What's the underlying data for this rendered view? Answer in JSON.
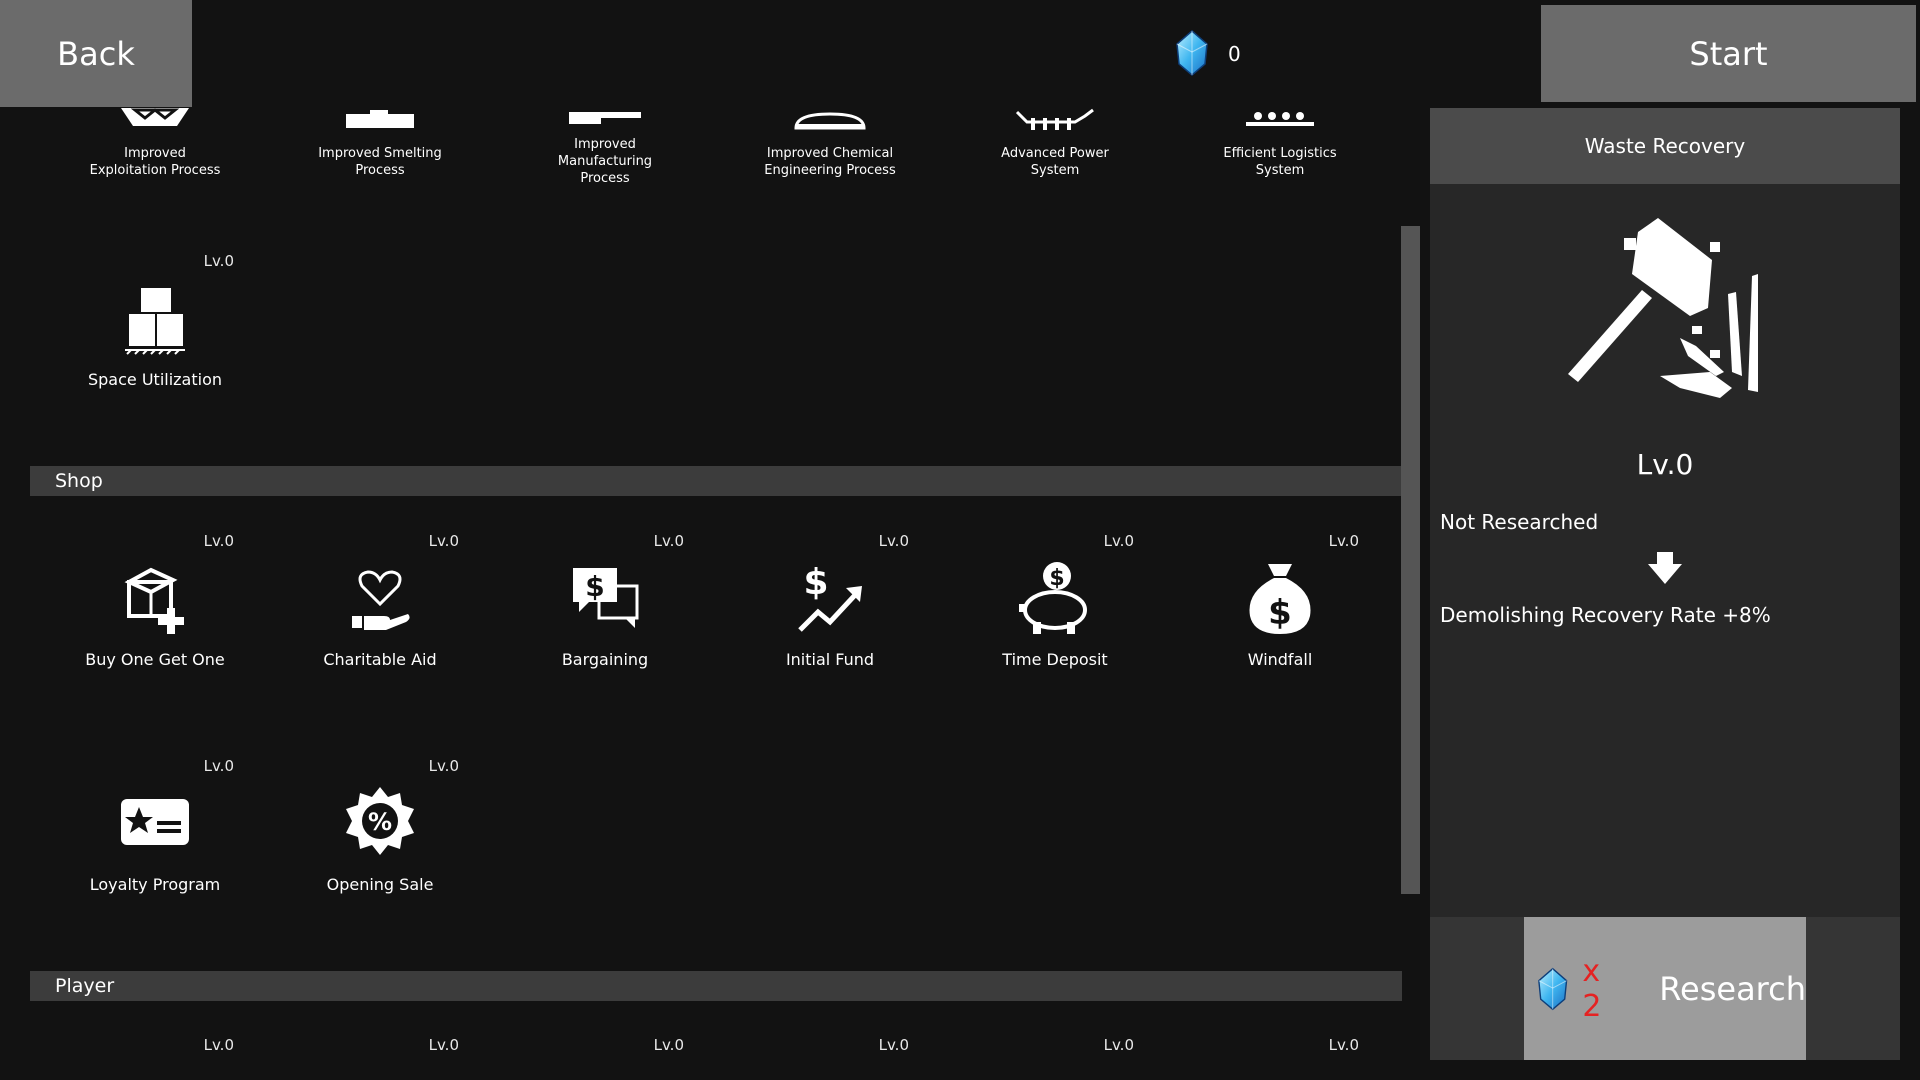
{
  "header": {
    "back_label": "Back",
    "start_label": "Start",
    "gem_count": "0"
  },
  "top_row": [
    {
      "name_lines": [
        "Improved",
        "Exploitation Process"
      ]
    },
    {
      "name_lines": [
        "Improved Smelting",
        "Process"
      ]
    },
    {
      "name_lines": [
        "Improved",
        "Manufacturing",
        "Process"
      ]
    },
    {
      "name_lines": [
        "Improved Chemical",
        "Engineering Process"
      ]
    },
    {
      "name_lines": [
        "Advanced Power",
        "System"
      ]
    },
    {
      "name_lines": [
        "Efficient Logistics",
        "System"
      ]
    }
  ],
  "space": {
    "level": "Lv.0",
    "name": "Space Utilization",
    "icon": "crates-icon"
  },
  "categories": {
    "shop": "Shop",
    "player": "Player"
  },
  "shop_items": [
    {
      "level": "Lv.0",
      "name": "Buy One Get One",
      "icon": "box-plus-icon"
    },
    {
      "level": "Lv.0",
      "name": "Charitable Aid",
      "icon": "heart-hand-icon"
    },
    {
      "level": "Lv.0",
      "name": "Bargaining",
      "icon": "speech-dollar-icon"
    },
    {
      "level": "Lv.0",
      "name": "Initial Fund",
      "icon": "dollar-chart-icon"
    },
    {
      "level": "Lv.0",
      "name": "Time Deposit",
      "icon": "piggy-bank-icon"
    },
    {
      "level": "Lv.0",
      "name": "Windfall",
      "icon": "money-bag-icon"
    },
    {
      "level": "Lv.0",
      "name": "Loyalty Program",
      "icon": "loyalty-card-icon"
    },
    {
      "level": "Lv.0",
      "name": "Opening Sale",
      "icon": "sale-badge-icon"
    }
  ],
  "player_levels": [
    "Lv.0",
    "Lv.0",
    "Lv.0",
    "Lv.0",
    "Lv.0",
    "Lv.0"
  ],
  "detail": {
    "title": "Waste Recovery",
    "level": "Lv.0",
    "status": "Not Researched",
    "effect": "Demolishing Recovery Rate +8%",
    "cost_label": "x 2",
    "research_label": "Research",
    "icon": "hammer-icon"
  },
  "colors": {
    "background": "#121212",
    "button": "#6b6b6b",
    "cost": "#e52222",
    "gem": "#3fb6f0"
  }
}
